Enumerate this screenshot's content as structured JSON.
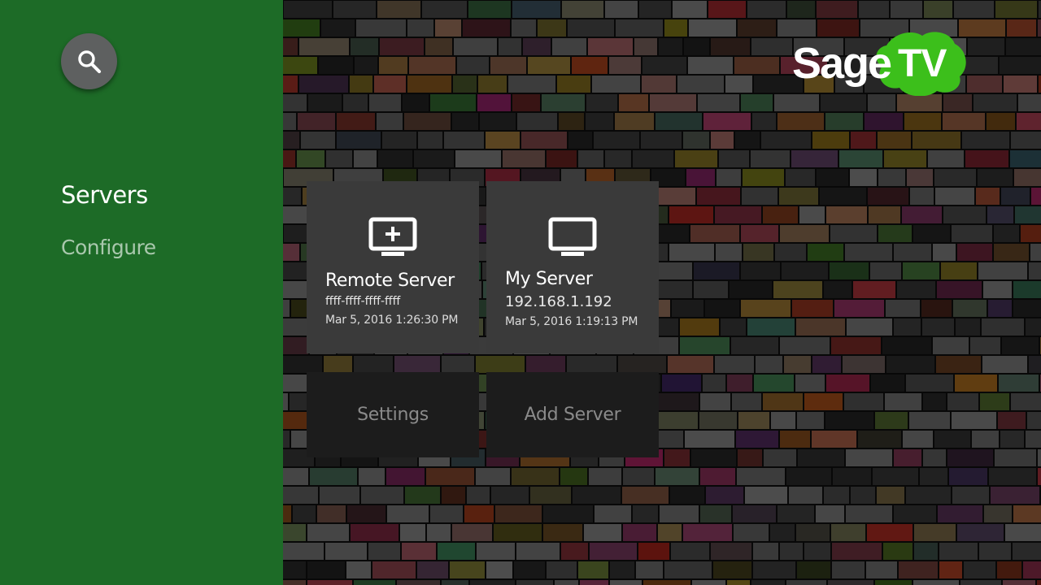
{
  "sidebar": {
    "search_icon": "search-icon",
    "items": [
      {
        "label": "Servers",
        "selected": true
      },
      {
        "label": "Configure",
        "selected": false
      }
    ]
  },
  "logo": {
    "text_sage": "Sage",
    "text_tv": "TV"
  },
  "servers": [
    {
      "title": "Remote Server",
      "id": "ffff-ffff-ffff-ffff",
      "date": "Mar 5, 2016 1:26:30 PM",
      "icon": "tv-add-icon"
    },
    {
      "title": "My Server",
      "id": "192.168.1.192",
      "date": "Mar 5, 2016 1:19:13 PM",
      "icon": "tv-icon"
    }
  ],
  "actions": {
    "settings_label": "Settings",
    "add_server_label": "Add Server"
  },
  "colors": {
    "sidebar": "#1d6b27",
    "card": "#3a3a3a",
    "action": "#1c1c1c",
    "logo_green": "#3cbf1b"
  }
}
